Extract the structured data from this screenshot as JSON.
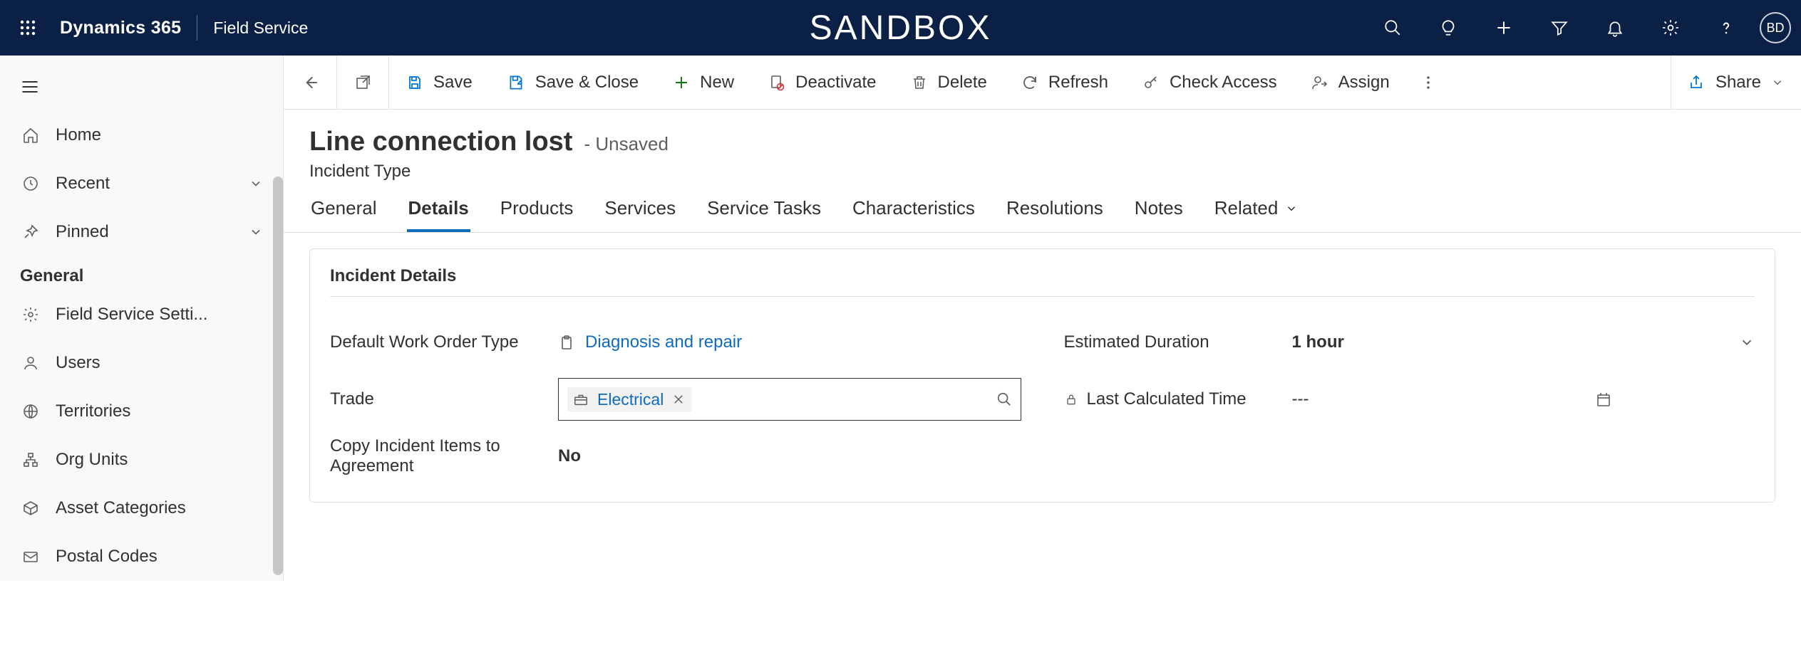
{
  "topnav": {
    "brand": "Dynamics 365",
    "area": "Field Service",
    "center": "SANDBOX",
    "avatar": "BD"
  },
  "sidebar": {
    "home": "Home",
    "recent": "Recent",
    "pinned": "Pinned",
    "group_general": "General",
    "items": [
      "Field Service Setti...",
      "Users",
      "Territories",
      "Org Units",
      "Asset Categories",
      "Postal Codes"
    ]
  },
  "cmdbar": {
    "save": "Save",
    "save_close": "Save & Close",
    "new": "New",
    "deactivate": "Deactivate",
    "delete": "Delete",
    "refresh": "Refresh",
    "check_access": "Check Access",
    "assign": "Assign",
    "share": "Share"
  },
  "header": {
    "title": "Line connection lost",
    "status": "- Unsaved",
    "entity": "Incident Type"
  },
  "tabs": [
    "General",
    "Details",
    "Products",
    "Services",
    "Service Tasks",
    "Characteristics",
    "Resolutions",
    "Notes",
    "Related"
  ],
  "section_title": "Incident Details",
  "fields": {
    "default_wo_type": {
      "label": "Default Work Order Type",
      "value": "Diagnosis and repair"
    },
    "trade": {
      "label": "Trade",
      "value": "Electrical"
    },
    "copy_items": {
      "label": "Copy Incident Items to Agreement",
      "value": "No"
    },
    "est_duration": {
      "label": "Estimated Duration",
      "value": "1 hour"
    },
    "last_calc": {
      "label": "Last Calculated Time",
      "value": "---"
    }
  }
}
